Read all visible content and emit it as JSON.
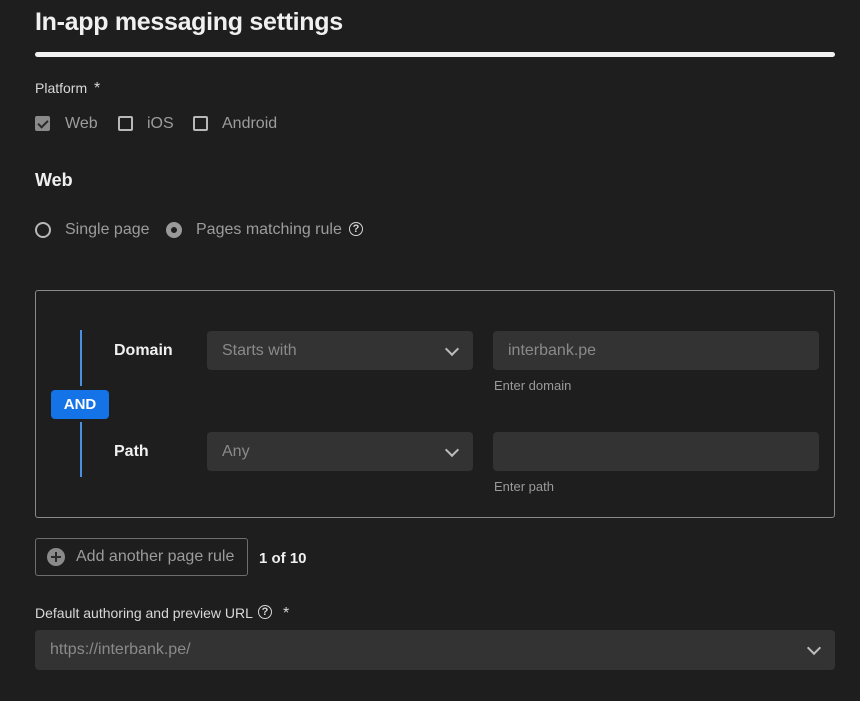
{
  "page": {
    "title": "In-app messaging settings"
  },
  "platform": {
    "label": "Platform",
    "required_mark": "*",
    "options": [
      {
        "label": "Web",
        "checked": true
      },
      {
        "label": "iOS",
        "checked": false
      },
      {
        "label": "Android",
        "checked": false
      }
    ]
  },
  "web": {
    "heading": "Web",
    "page_mode": {
      "options": [
        {
          "label": "Single page",
          "selected": false
        },
        {
          "label": "Pages matching rule",
          "selected": true
        }
      ],
      "help_glyph": "?"
    }
  },
  "rules": {
    "operator": "AND",
    "domain": {
      "label": "Domain",
      "match": "Starts with",
      "value": "interbank.pe",
      "helper": "Enter domain"
    },
    "path": {
      "label": "Path",
      "match": "Any",
      "value": "",
      "helper": "Enter path"
    },
    "add_button_label": "Add another page rule",
    "count_text": "1 of 10"
  },
  "default_url": {
    "label": "Default authoring and preview URL",
    "help_glyph": "?",
    "required_mark": "*",
    "value": "https://interbank.pe/"
  },
  "colors": {
    "background": "#1e1e1e",
    "accent": "#1473e6",
    "rule_line": "#4a90e2"
  }
}
